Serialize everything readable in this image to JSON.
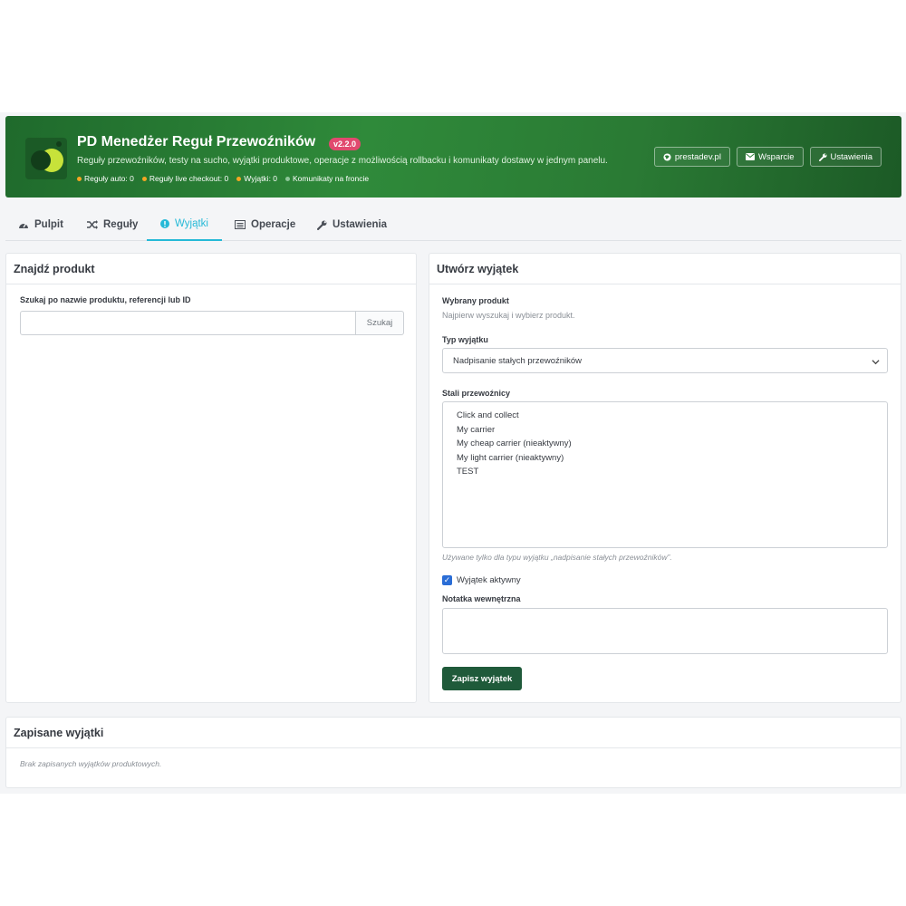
{
  "header": {
    "title": "PD Menedżer Reguł Przewoźników",
    "version": "v2.2.0",
    "subtitle": "Reguły przewoźników, testy na sucho, wyjątki produktowe, operacje z możliwością rollbacku i komunikaty dostawy w jednym panelu.",
    "stats": [
      {
        "label": "Reguły auto: 0",
        "color": "#f5a623"
      },
      {
        "label": "Reguły live checkout: 0",
        "color": "#f5a623"
      },
      {
        "label": "Wyjątki: 0",
        "color": "#f5a623"
      },
      {
        "label": "Komunikaty na froncie",
        "color": "#8fc79a"
      }
    ],
    "buttons": [
      {
        "label": "prestadev.pl",
        "icon": "globe-icon"
      },
      {
        "label": "Wsparcie",
        "icon": "envelope-icon"
      },
      {
        "label": "Ustawienia",
        "icon": "wrench-icon"
      }
    ]
  },
  "tabs": [
    {
      "label": "Pulpit",
      "icon": "dashboard-icon",
      "active": false
    },
    {
      "label": "Reguły",
      "icon": "shuffle-icon",
      "active": false
    },
    {
      "label": "Wyjątki",
      "icon": "exclamation-icon",
      "active": true
    },
    {
      "label": "Operacje",
      "icon": "list-icon",
      "active": false
    },
    {
      "label": "Ustawienia",
      "icon": "wrench-icon",
      "active": false
    }
  ],
  "find_panel": {
    "title": "Znajdź produkt",
    "search_label": "Szukaj po nazwie produktu, referencji lub ID",
    "search_value": "",
    "search_button": "Szukaj"
  },
  "create_panel": {
    "title": "Utwórz wyjątek",
    "selected_label": "Wybrany produkt",
    "selected_help": "Najpierw wyszukaj i wybierz produkt.",
    "type_label": "Typ wyjątku",
    "type_value": "Nadpisanie stałych przewoźników",
    "carriers_label": "Stali przewoźnicy",
    "carriers": [
      "Click and collect",
      "My carrier",
      "My cheap carrier (nieaktywny)",
      "My light carrier (nieaktywny)",
      "TEST"
    ],
    "carriers_help": "Używane tylko dla typu wyjątku „nadpisanie stałych przewoźników”.",
    "active_label": "Wyjątek aktywny",
    "active_checked": true,
    "note_label": "Notatka wewnętrzna",
    "note_value": "",
    "save_button": "Zapisz wyjątek"
  },
  "saved_panel": {
    "title": "Zapisane wyjątki",
    "empty_text": "Brak zapisanych wyjątków produktowych."
  }
}
